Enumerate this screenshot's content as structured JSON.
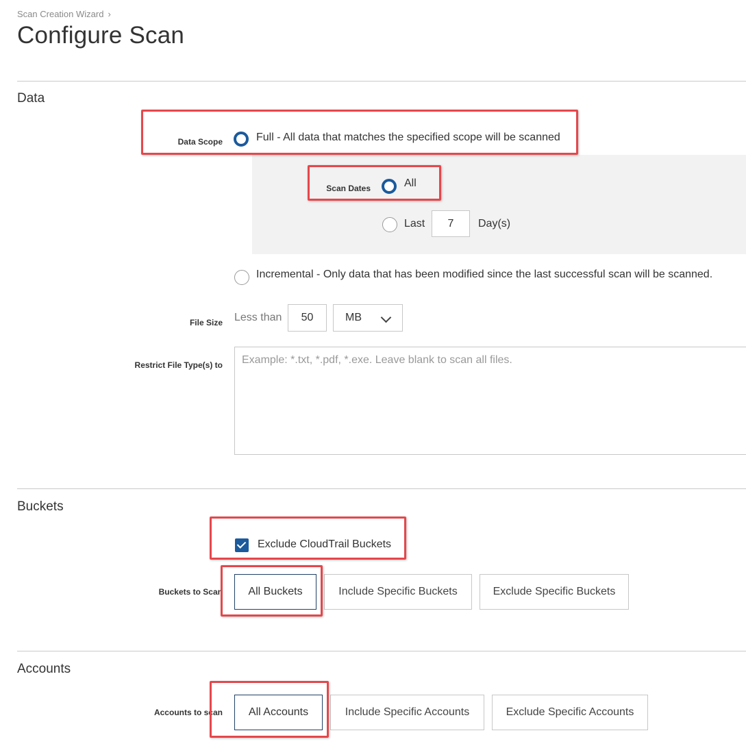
{
  "header": {
    "breadcrumb": "Scan Creation Wizard",
    "breadcrumb_separator": "›",
    "title": "Configure Scan"
  },
  "data_section": {
    "title": "Data",
    "data_scope_label": "Data Scope",
    "full_option": "Full - All data that matches the specified scope will be scanned",
    "scan_dates_label": "Scan Dates",
    "all_option": "All",
    "last_option": "Last",
    "last_days_value": "7",
    "days_unit": "Day(s)",
    "incremental_option": "Incremental - Only data that has been modified since the last successful scan will be scanned.",
    "file_size_label": "File Size",
    "less_than_text": "Less than",
    "file_size_value": "50",
    "file_size_unit": "MB",
    "restrict_label": "Restrict File Type(s) to",
    "restrict_placeholder": "Example: *.txt, *.pdf, *.exe. Leave blank to scan all files."
  },
  "buckets_section": {
    "title": "Buckets",
    "exclude_cloudtrail_label": "Exclude CloudTrail Buckets",
    "exclude_cloudtrail_checked": true,
    "buckets_to_scan_label": "Buckets to Scan",
    "options": [
      "All Buckets",
      "Include Specific Buckets",
      "Exclude Specific Buckets"
    ],
    "selected": "All Buckets"
  },
  "accounts_section": {
    "title": "Accounts",
    "accounts_to_scan_label": "Accounts to scan",
    "options": [
      "All Accounts",
      "Include Specific Accounts",
      "Exclude Specific Accounts"
    ],
    "selected": "All Accounts"
  },
  "colors": {
    "accent": "#1b5a9c",
    "highlight": "#e5474b",
    "panel": "#f2f2f2"
  }
}
